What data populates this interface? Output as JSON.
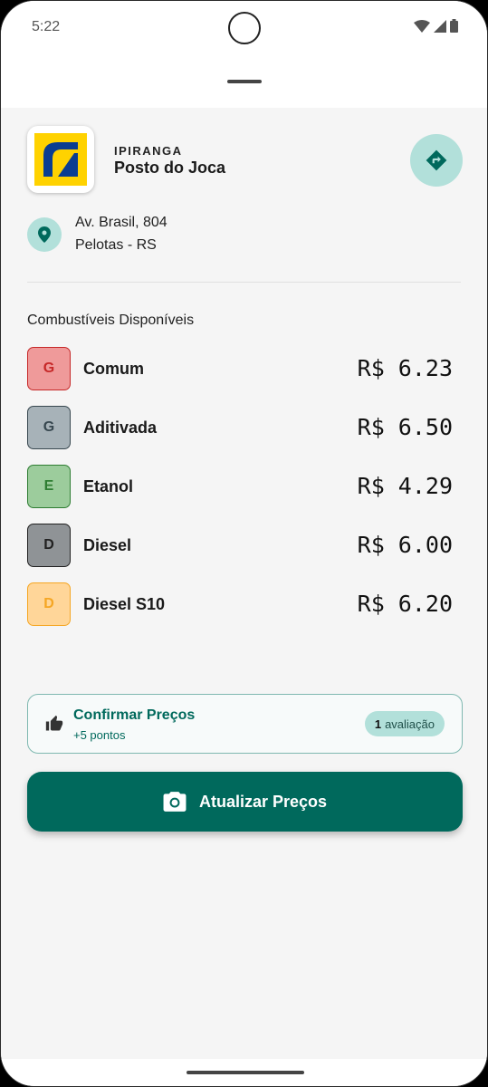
{
  "status_bar": {
    "time": "5:22"
  },
  "station": {
    "brand": "IPIRANGA",
    "name": "Posto do Joca",
    "address_line1": "Av. Brasil, 804",
    "address_line2": "Pelotas - RS"
  },
  "fuels": {
    "section_title": "Combustíveis Disponíveis",
    "items": [
      {
        "code": "G",
        "name": "Comum",
        "price": "R$ 6.23",
        "color": "#e57373"
      },
      {
        "code": "G",
        "name": "Aditivada",
        "price": "R$ 6.50",
        "color": "#90a4ae"
      },
      {
        "code": "E",
        "name": "Etanol",
        "price": "R$ 4.29",
        "color": "#81c784"
      },
      {
        "code": "D",
        "name": "Diesel",
        "price": "R$ 6.00",
        "color": "#757575"
      },
      {
        "code": "D",
        "name": "Diesel S10",
        "price": "R$ 6.20",
        "color": "#ffb74d"
      }
    ]
  },
  "confirm": {
    "title": "Confirmar Preços",
    "subtitle": "+5 pontos",
    "rating_count": "1",
    "rating_label": "avaliação"
  },
  "update_button": {
    "label": "Atualizar Preços"
  },
  "colors": {
    "primary": "#00695c",
    "accent_light": "#b2e0da",
    "brand_yellow": "#ffd200",
    "brand_blue": "#0a3d91"
  },
  "icons": {
    "directions": "directions-icon",
    "location": "location-pin-icon",
    "thumb": "thumb-up-icon",
    "camera": "camera-icon"
  }
}
